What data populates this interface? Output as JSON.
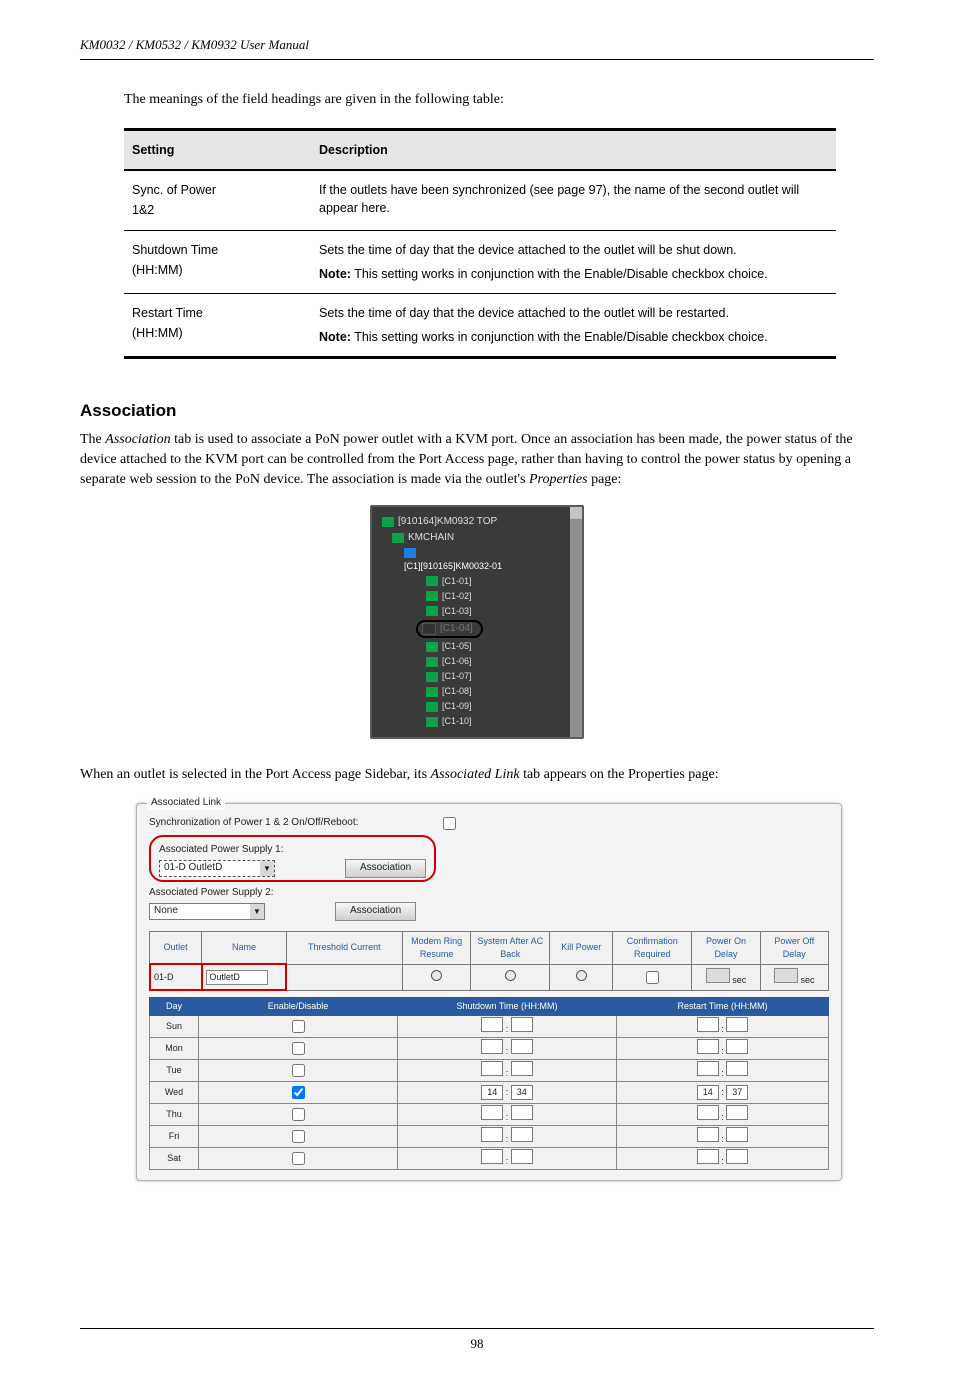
{
  "header": {
    "doc_title": "KM0032 / KM0532 / KM0932 User Manual"
  },
  "footer": {
    "page": "98"
  },
  "intro_text": "The meanings of the field headings are given in the following table:",
  "settings_table": {
    "cols": [
      "Setting",
      "Description"
    ],
    "rows": [
      {
        "label_a": "Sync. of Power",
        "label_b": "1&2",
        "desc": "If the outlets have been synchronized (see page 97), the name of the second outlet will appear here."
      },
      {
        "label_a": "Shutdown Time",
        "label_b": "(HH:MM)",
        "desc_a": "Sets the time of day that the device attached to the outlet will be shut down.",
        "note": "Note: This setting works in conjunction with the Enable/Disable checkbox choice."
      },
      {
        "label_a": "Restart Time",
        "label_b": "(HH:MM)",
        "desc_a": "Sets the time of day that the device attached to the outlet will be restarted.",
        "note": "Note: This setting works in conjunction with the Enable/Disable checkbox choice."
      }
    ]
  },
  "section": {
    "title": "Association",
    "para1_a": "The ",
    "para1_i": "Association",
    "para1_b": " tab is used to associate a PoN power outlet with a KVM port. Once an association has been made, the power status of the device attached to the KVM port can be controlled from the Port Access page, rather than having to control the power status by opening a separate web session to the PoN device. The association is made via the outlet's ",
    "para1_c": "Properties",
    "para1_d": " page:"
  },
  "tree": {
    "root": "[910164]KM0932 TOP",
    "chain": "KMCHAIN",
    "sub": "[C1][910165]KM0032-01",
    "items": [
      "[C1-01]",
      "[C1-02]",
      "[C1-03]",
      "[C1-04]",
      "[C1-05]",
      "[C1-06]",
      "[C1-07]",
      "[C1-08]",
      "[C1-09]",
      "[C1-10]"
    ]
  },
  "after_para_a": "When an outlet is selected in the Port Access page Sidebar, its ",
  "after_para_b": "Associated Link",
  "after_para_c": " tab appears on the Properties page:",
  "panel": {
    "title": "Associated Link",
    "sync_label": "Synchronization of Power 1 & 2 On/Off/Reboot:",
    "aps1_label": "Associated Power Supply 1:",
    "aps1_value": "01-D  OutletD",
    "aps2_label": "Associated Power Supply 2:",
    "aps2_value": "None",
    "assoc_button": "Association",
    "outlet_cols": [
      "Outlet",
      "Name",
      "Threshold Current",
      "Modem Ring Resume",
      "System After AC Back",
      "Kill Power",
      "Confirmation Required",
      "Power On Delay",
      "Power Off Delay"
    ],
    "outlet_row": {
      "id": "01-D",
      "name": "OutletD",
      "unit": "sec"
    },
    "day_cols": [
      "Day",
      "Enable/Disable",
      "Shutdown Time (HH:MM)",
      "Restart Time (HH:MM)"
    ],
    "days": [
      "Sun",
      "Mon",
      "Tue",
      "Wed",
      "Thu",
      "Fri",
      "Sat"
    ],
    "wed_shutdown_h": "14",
    "wed_shutdown_m": "34",
    "wed_restart_h": "14",
    "wed_restart_m": "37"
  }
}
